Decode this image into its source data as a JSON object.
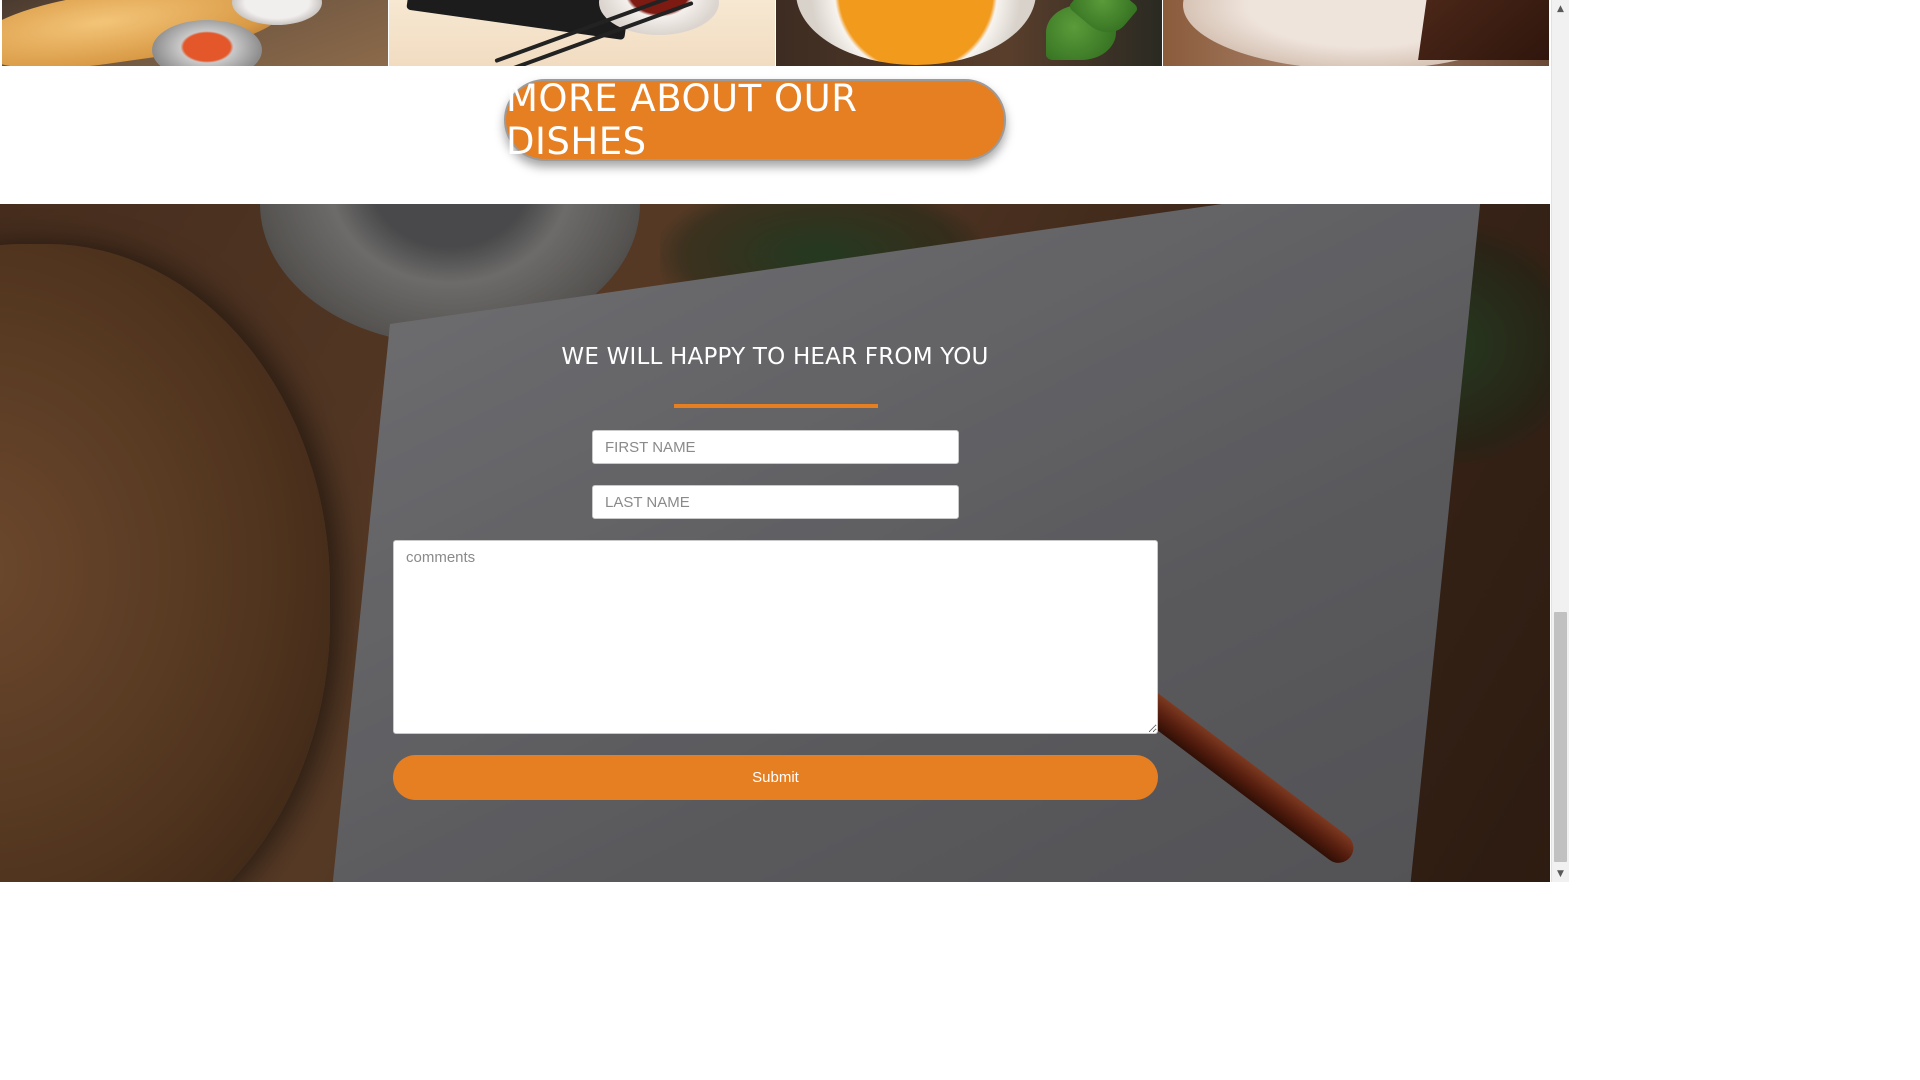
{
  "dishes": {
    "images": [
      "dosa-plate",
      "sushi-tray",
      "tomato-soup",
      "chocolate-cake"
    ]
  },
  "more_button": {
    "label": "MORE ABOUT OUR DISHES"
  },
  "contact_form": {
    "title": "WE WILL HAPPY TO HEAR FROM YOU",
    "accent_color": "#e67e22",
    "first_name": {
      "placeholder": "FIRST NAME",
      "value": ""
    },
    "last_name": {
      "placeholder": "LAST NAME",
      "value": ""
    },
    "comments": {
      "placeholder": "comments",
      "value": ""
    },
    "submit_label": "Submit"
  },
  "scrollbar": {
    "up_icon": "▲",
    "down_icon": "▼"
  }
}
